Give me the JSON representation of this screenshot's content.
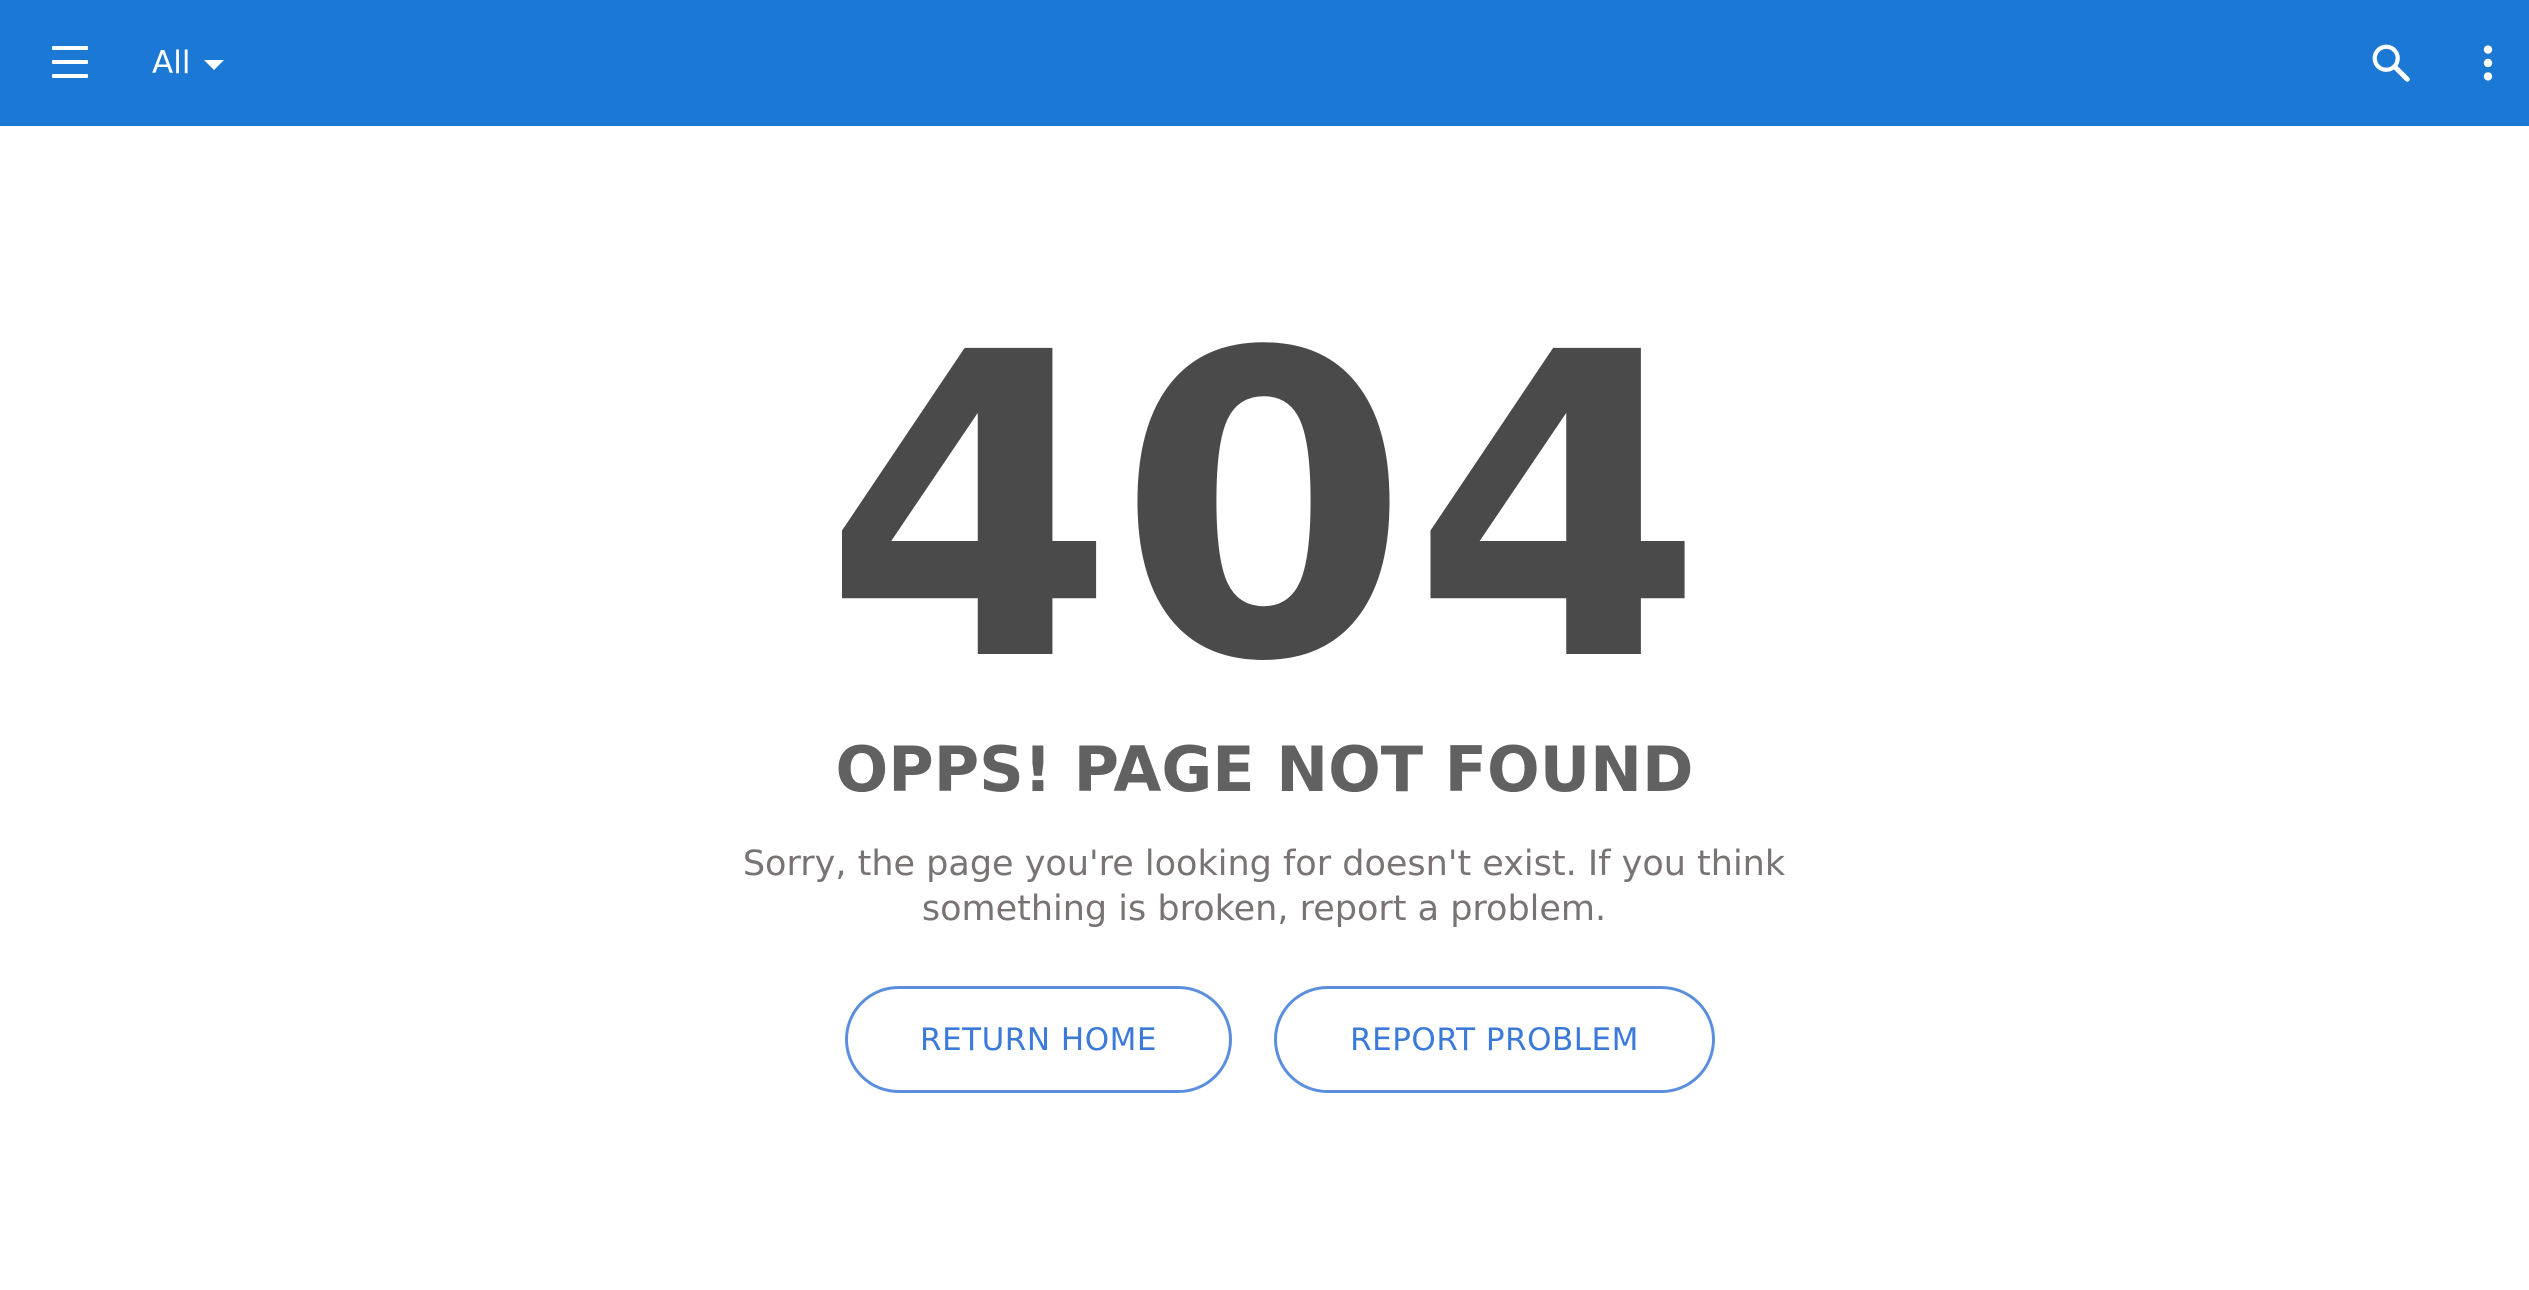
{
  "header": {
    "filter_label": "All",
    "menu_icon": "hamburger-menu-icon",
    "search_icon": "search-icon",
    "more_icon": "more-vertical-icon",
    "background_color": "#1b78d4"
  },
  "error": {
    "code": "404",
    "title": "OPPS! PAGE NOT FOUND",
    "message": "Sorry, the page you're looking for doesn't exist. If you think something is broken, report a problem."
  },
  "actions": {
    "return_home_label": "RETURN HOME",
    "report_problem_label": "REPORT PROBLEM",
    "accent_color": "#3b7ad9"
  }
}
